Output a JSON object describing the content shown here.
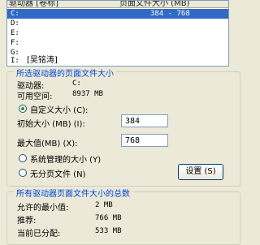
{
  "drive_list": {
    "header_drive": "驱动器 [卷标]",
    "header_size": "页面文件大小 (MB)",
    "rows": [
      {
        "letter": "C:",
        "label": "",
        "size": "384 - 768"
      },
      {
        "letter": "D:",
        "label": "",
        "size": ""
      },
      {
        "letter": "E:",
        "label": "",
        "size": ""
      },
      {
        "letter": "F:",
        "label": "",
        "size": ""
      },
      {
        "letter": "G:",
        "label": "",
        "size": ""
      },
      {
        "letter": "I:",
        "label": "[吴铭涛]",
        "size": ""
      }
    ]
  },
  "selected_drive": {
    "title": "所选驱动器的页面文件大小",
    "drive_label": "驱动器:",
    "drive_value": "C:",
    "space_label": "可用空间:",
    "space_value": "8937 MB",
    "custom_label": "自定义大小 (C):",
    "initial_label": "初始大小 (MB) (I):",
    "initial_value": "384",
    "max_label": "最大值(MB) (X):",
    "max_value": "768",
    "system_managed_label": "系统管理的大小 (Y)",
    "no_paging_label": "无分页文件 (N)",
    "set_button": "设置 (S)"
  },
  "totals": {
    "title": "所有驱动器页面文件大小的总数",
    "min_label": "允许的最小值:",
    "min_value": "2 MB",
    "recommended_label": "推荐:",
    "recommended_value": "766 MB",
    "current_label": "当前已分配:",
    "current_value": "533 MB"
  },
  "colors": {
    "group_title": "#0046d5",
    "selection": "#316ac5"
  }
}
